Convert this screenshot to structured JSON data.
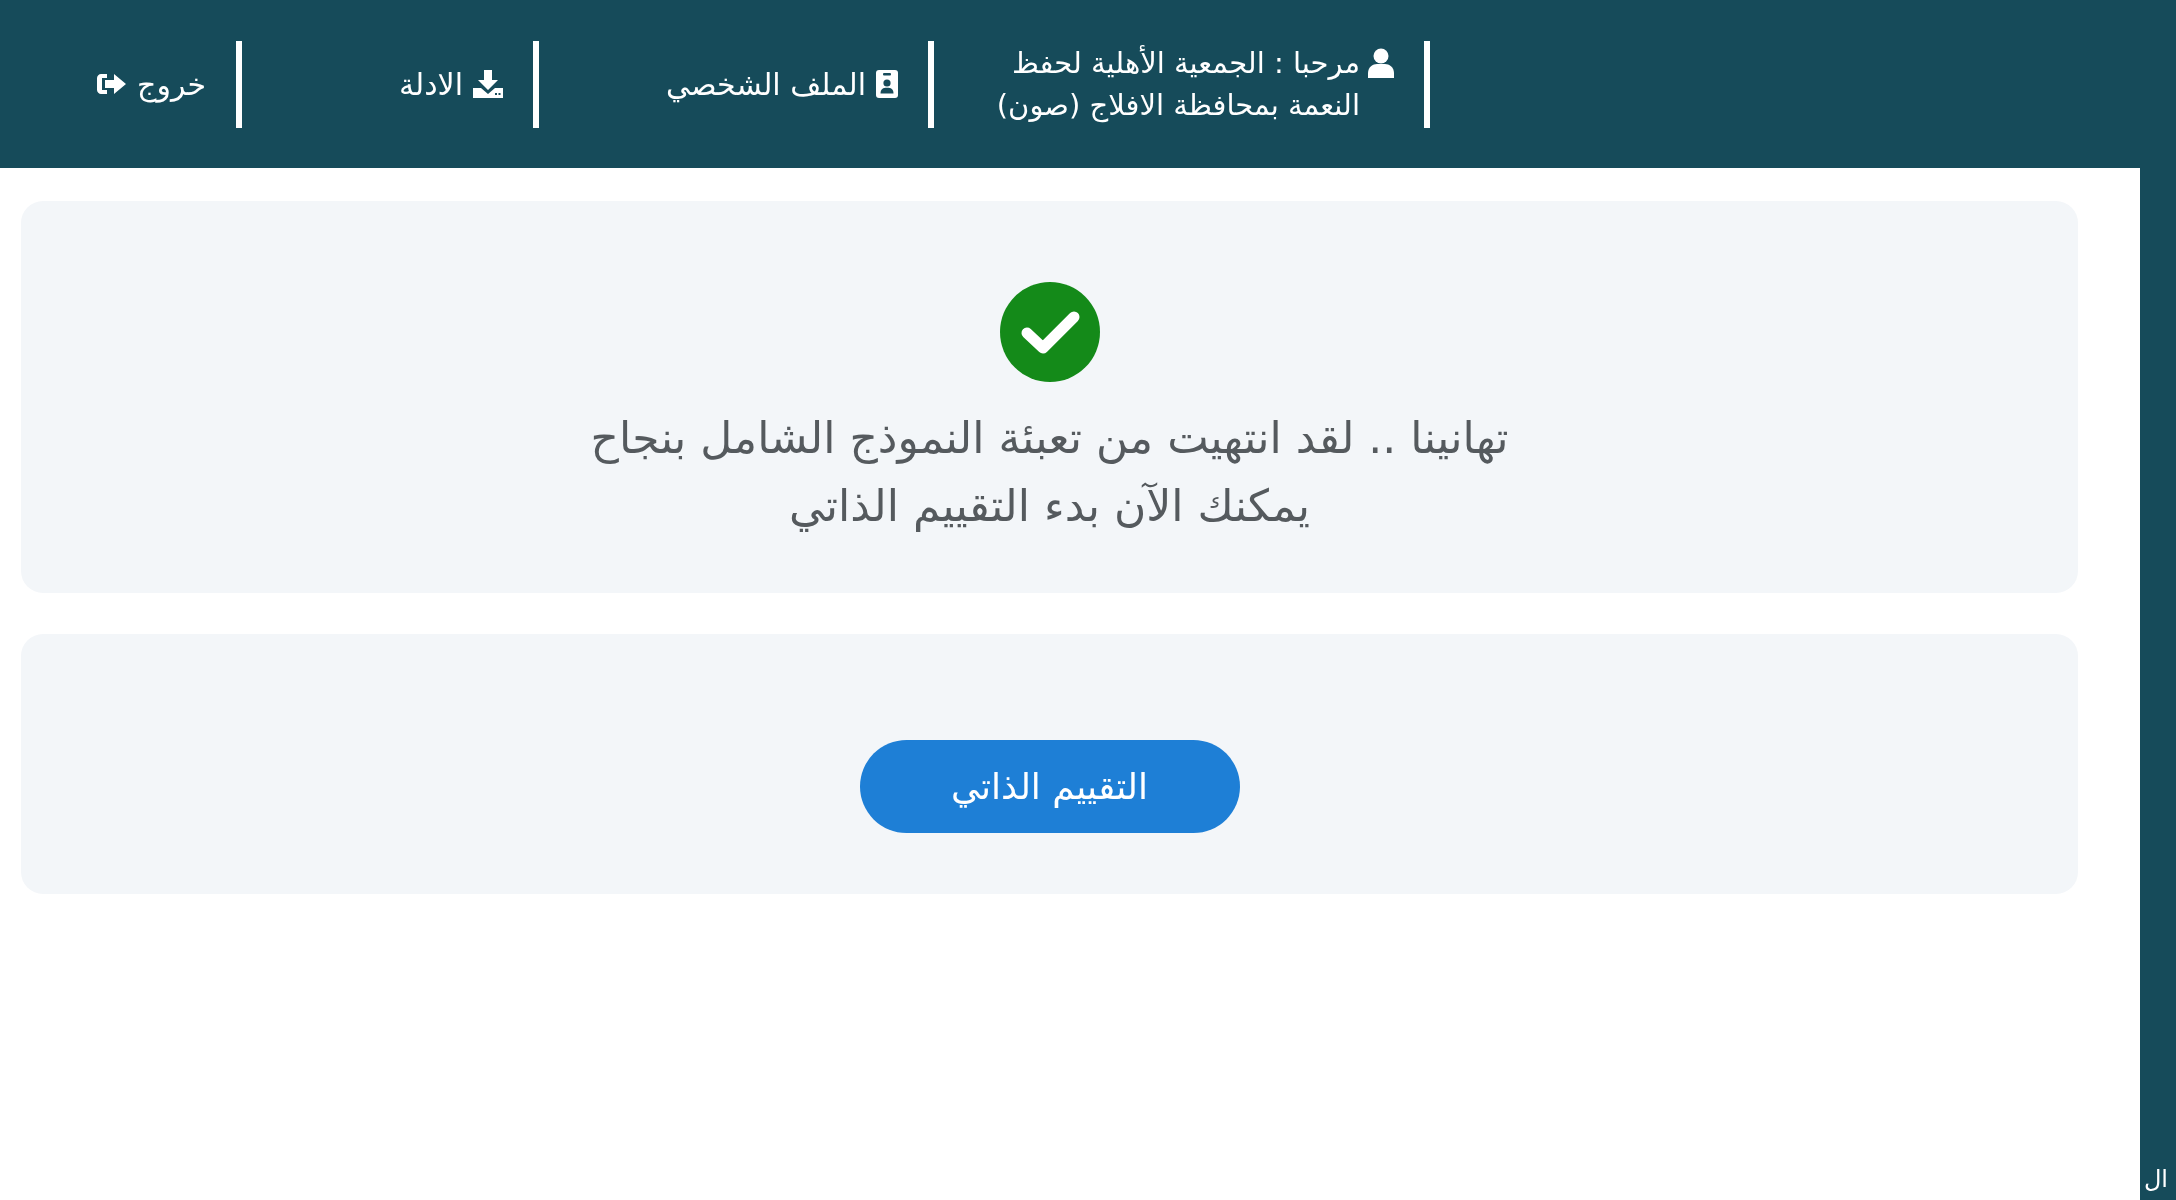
{
  "header": {
    "welcome": "مرحبا : الجمعية الأهلية لحفظ النعمة بمحافظة الافلاج (صون)",
    "links": [
      {
        "kind": "profile",
        "label": "الملف الشخصي"
      },
      {
        "kind": "guides",
        "label": "الادلة"
      },
      {
        "kind": "logout",
        "label": "خروج"
      }
    ]
  },
  "success_card": {
    "lines": [
      "تهانينا .. لقد انتهيت من تعبئة النموذج الشامل بنجاح",
      "يمكنك الآن بدء التقييم الذاتي"
    ]
  },
  "action_card": {
    "button": "التقييم الذاتي"
  },
  "side_panel": {
    "text": "ال"
  }
}
